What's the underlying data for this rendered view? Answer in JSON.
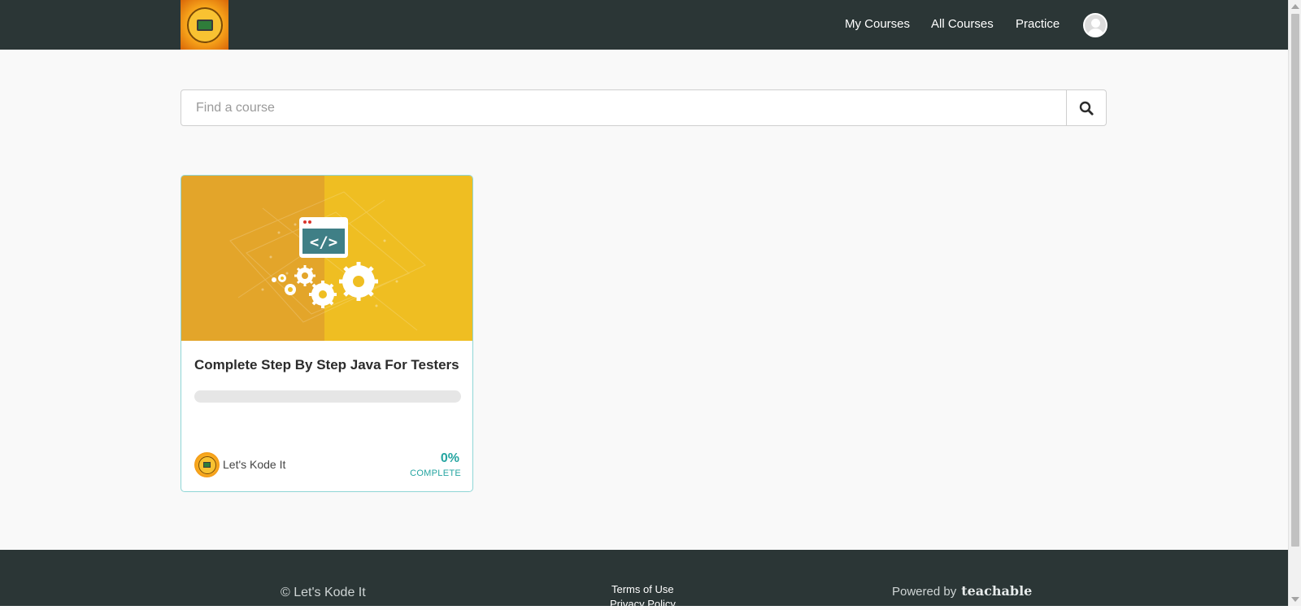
{
  "header": {
    "logo_alt": "Let's Kode It",
    "nav": [
      {
        "label": "My Courses"
      },
      {
        "label": "All Courses"
      },
      {
        "label": "Practice"
      }
    ]
  },
  "search": {
    "placeholder": "Find a course",
    "value": ""
  },
  "courses": [
    {
      "title": "Complete Step By Step Java For Testers",
      "author": "Let's Kode It",
      "progress_percent": 0,
      "progress_label": "0%",
      "complete_label": "COMPLETE",
      "image_icon": "code-window-with-gears-icon"
    }
  ],
  "footer": {
    "copyright": "© Let's Kode It",
    "links": [
      {
        "label": "Terms of Use"
      },
      {
        "label": "Privacy Policy"
      }
    ],
    "powered_by": "Powered by",
    "powered_brand": "teachable"
  },
  "colors": {
    "navbar": "#2b3636",
    "accent": "#25a5a1",
    "card_border": "#8fd6d6",
    "card_image_left": "#e3a52a",
    "card_image_right": "#efbe22"
  }
}
